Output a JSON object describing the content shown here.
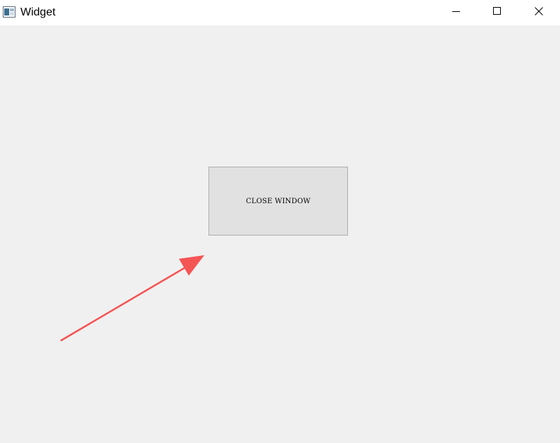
{
  "window": {
    "title": "Widget",
    "app_icon": "window-app-icon",
    "controls": {
      "minimize_icon": "minimize-icon",
      "maximize_icon": "maximize-icon",
      "close_icon": "close-icon"
    },
    "background_color": "#f0f0f0"
  },
  "main": {
    "close_button_label": "CLOSE WINDOW"
  },
  "annotation": {
    "icon": "arrow-icon",
    "color": "#f55454"
  }
}
